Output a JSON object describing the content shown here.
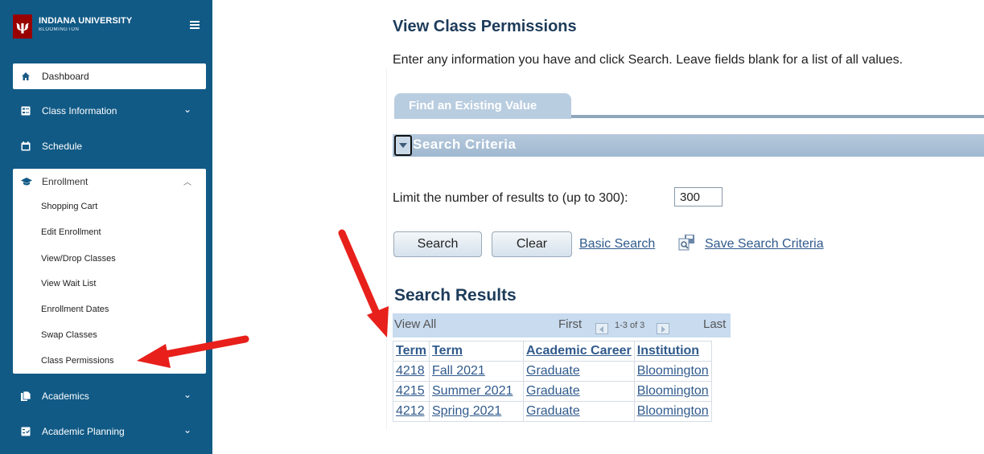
{
  "sidebar": {
    "brand_name": "INDIANA UNIVERSITY",
    "brand_sub": "BLOOMINGTON",
    "dashboard": "Dashboard",
    "class_information": "Class Information",
    "schedule": "Schedule",
    "enrollment": "Enrollment",
    "enrollment_items": [
      "Shopping Cart",
      "Edit Enrollment",
      "View/Drop Classes",
      "View Wait List",
      "Enrollment Dates",
      "Swap Classes",
      "Class Permissions"
    ],
    "academics": "Academics",
    "academic_planning": "Academic Planning"
  },
  "main": {
    "title": "View Class Permissions",
    "instructions": "Enter any information you have and click Search. Leave fields blank for a list of all values.",
    "tab_label": "Find an Existing Value",
    "criteria_header": "Search Criteria",
    "limit_label": "Limit the number of results to (up to 300):",
    "limit_value": "300",
    "search_button": "Search",
    "clear_button": "Clear",
    "basic_search_link": "Basic Search",
    "save_criteria_link": "Save Search Criteria",
    "results_title": "Search Results"
  },
  "grid": {
    "view_all": "View All",
    "first": "First",
    "range": "1-3 of 3",
    "last": "Last",
    "headers": [
      "Term",
      "Term",
      "Academic Career",
      "Institution"
    ],
    "rows": [
      [
        "4218",
        "Fall 2021",
        "Graduate",
        "Bloomington"
      ],
      [
        "4215",
        "Summer 2021",
        "Graduate",
        "Bloomington"
      ],
      [
        "4212",
        "Spring 2021",
        "Graduate",
        "Bloomington"
      ]
    ]
  },
  "colors": {
    "sidebar_bg": "#115a86",
    "iu_crimson": "#990000",
    "arrow_red": "#e8201b",
    "link_blue": "#305a8c"
  }
}
